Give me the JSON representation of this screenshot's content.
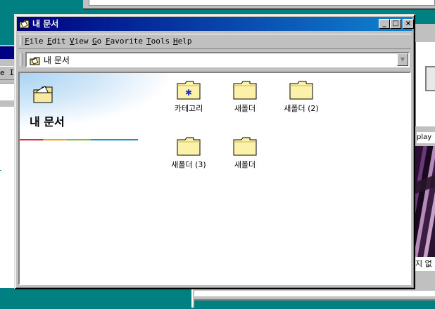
{
  "window": {
    "title": "내 문서",
    "buttons": {
      "minimize": "_",
      "maximize": "□",
      "close": "×"
    }
  },
  "menubar": [
    {
      "underline": "F",
      "rest": "ile"
    },
    {
      "underline": "E",
      "rest": "dit"
    },
    {
      "underline": "V",
      "rest": "iew"
    },
    {
      "underline": "G",
      "rest": "o"
    },
    {
      "underline": "F",
      "rest": "avorite"
    },
    {
      "underline": "T",
      "rest": "ools"
    },
    {
      "underline": "H",
      "rest": "elp"
    }
  ],
  "address": {
    "value": "내 문서",
    "dropdown": "▼"
  },
  "sidebar": {
    "title": "내 문서"
  },
  "folders": [
    {
      "label": "카테고리",
      "special": true
    },
    {
      "label": "새폴더"
    },
    {
      "label": "새폴더 (2)"
    },
    {
      "label": "새폴더 (3)"
    },
    {
      "label": "새폴더"
    }
  ],
  "background": {
    "left_menu_fragment": "e I",
    "right_label_fragment": "play",
    "right_text_fragment": "지 없"
  }
}
